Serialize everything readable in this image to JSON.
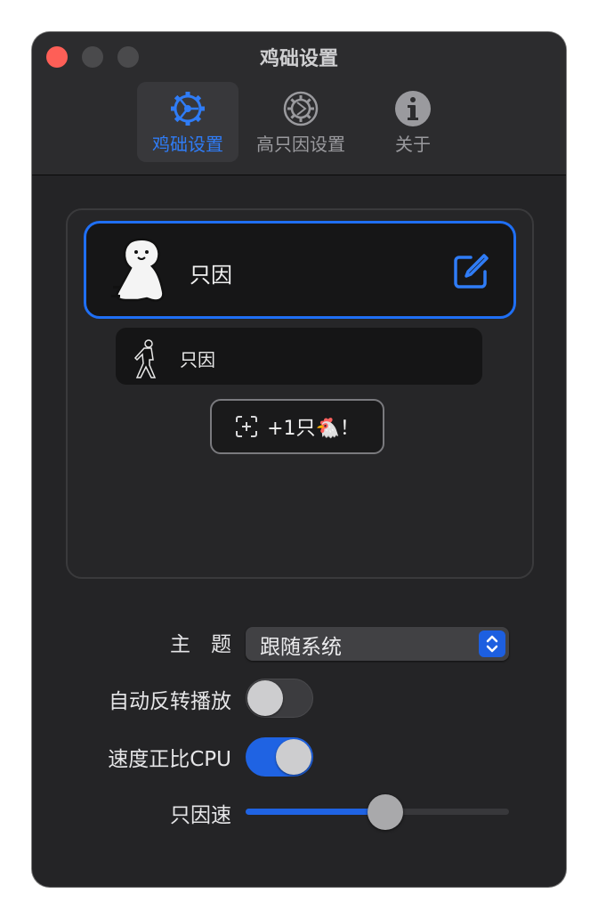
{
  "window": {
    "title": "鸡础设置"
  },
  "tabs": [
    {
      "label": "鸡础设置",
      "icon": "gear-icon",
      "active": true
    },
    {
      "label": "高只因设置",
      "icon": "gear-advanced-icon",
      "active": false
    },
    {
      "label": "关于",
      "icon": "info-icon",
      "active": false
    }
  ],
  "items": [
    {
      "name": "只因",
      "icon": "cartoon-avatar-icon",
      "selected": true
    },
    {
      "name": "只因",
      "icon": "dancer-silhouette-icon",
      "selected": false
    }
  ],
  "add_button": {
    "label": "+1只🐔！"
  },
  "settings": {
    "theme": {
      "label": "主　题",
      "value": "跟随系统"
    },
    "auto_reverse": {
      "label": "自动反转播放",
      "on": false
    },
    "speed_cpu": {
      "label": "速度正比CPU",
      "on": true
    },
    "speed": {
      "label": "只因速",
      "value": 0.53
    }
  },
  "colors": {
    "accent": "#1f63e3",
    "accent_text": "#2f7cf6",
    "background": "#242426",
    "close": "#fe5f57"
  }
}
